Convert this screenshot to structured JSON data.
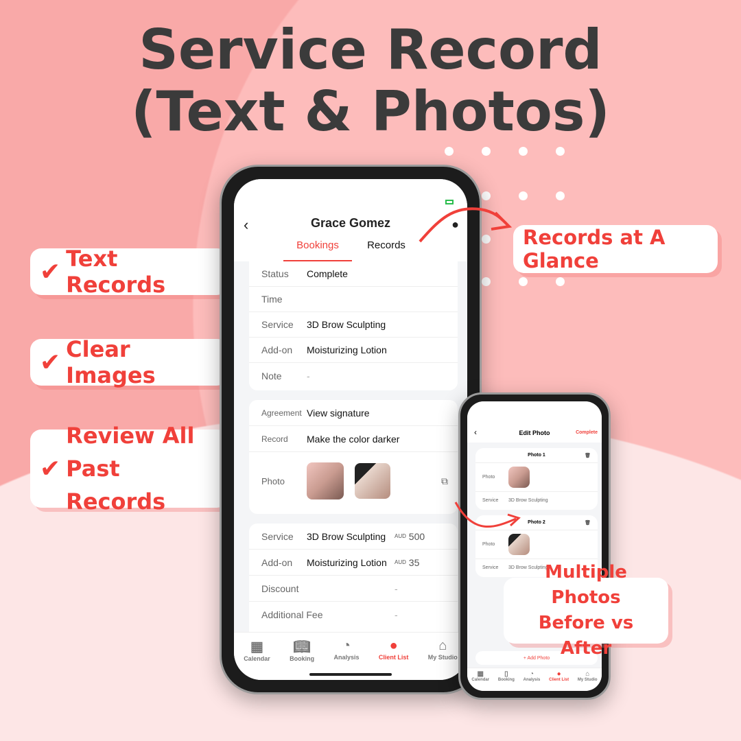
{
  "title": {
    "line1": "Service Record",
    "line2": "(Text & Photos)"
  },
  "callouts": {
    "text_records": "Text Records",
    "clear_images": "Clear Images",
    "review_line1": "Review All",
    "review_line2": "Past Records",
    "glance": "Records at A Glance",
    "multi_line1": "Multiple Photos",
    "multi_line2": "Before vs After",
    "check": "✔"
  },
  "colors": {
    "accent": "#f0403a",
    "title": "#3b3b3b",
    "background": "#f9a9a8"
  },
  "main_phone": {
    "client_name": "Grace Gomez",
    "tabs": [
      {
        "label": "Bookings",
        "active": true
      },
      {
        "label": "Records",
        "active": false
      }
    ],
    "card1": [
      {
        "k": "Status",
        "v": "Complete"
      },
      {
        "k": "Time",
        "v": ""
      },
      {
        "k": "Service",
        "v": "3D Brow Sculpting"
      },
      {
        "k": "Add-on",
        "v": "Moisturizing Lotion"
      },
      {
        "k": "Note",
        "v": "-"
      }
    ],
    "card2": {
      "agreement_label": "Agreement",
      "agreement_value": "View signature",
      "record_label": "Record",
      "record_value": "Make the color darker",
      "photo_label": "Photo"
    },
    "card3": [
      {
        "k": "Service",
        "v": "3D Brow Sculpting",
        "cur": "AUD",
        "amt": "500"
      },
      {
        "k": "Add-on",
        "v": "Moisturizing Lotion",
        "cur": "AUD",
        "amt": "35"
      },
      {
        "k": "Discount",
        "v": "",
        "cur": "",
        "amt": "-"
      },
      {
        "k": "Additional Fee",
        "v": "",
        "cur": "",
        "amt": "-"
      }
    ],
    "nav": [
      {
        "label": "Calendar",
        "icon": "calendar-icon"
      },
      {
        "label": "Booking",
        "icon": "book-icon"
      },
      {
        "label": "Analysis",
        "icon": "pie-chart-icon"
      },
      {
        "label": "Client List",
        "icon": "person-icon",
        "active": true
      },
      {
        "label": "My Studio",
        "icon": "home-icon"
      }
    ]
  },
  "small_phone": {
    "title": "Edit Photo",
    "complete": "Complete",
    "photos": [
      {
        "name": "Photo 1",
        "photo_label": "Photo",
        "service_label": "Service",
        "service": "3D Brow Sculpting"
      },
      {
        "name": "Photo 2",
        "photo_label": "Photo",
        "service_label": "Service",
        "service": "3D Brow Sculpting"
      }
    ],
    "add_photo": "+ Add Photo",
    "nav": [
      {
        "label": "Calendar"
      },
      {
        "label": "Booking"
      },
      {
        "label": "Analysis"
      },
      {
        "label": "Client List",
        "active": true
      },
      {
        "label": "My Studio"
      }
    ]
  }
}
